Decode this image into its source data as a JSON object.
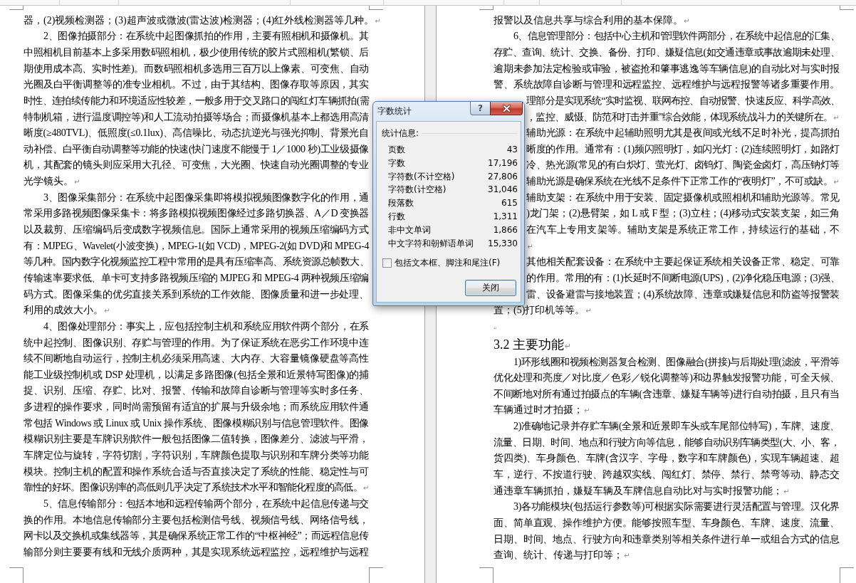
{
  "pages": [
    {
      "paragraphs": [
        {
          "kind": "continued",
          "lines": [
            "器，(2)视频检测器；(3)超声波或微波(雷达波)检测器；(4)红外线检测器等几种。"
          ],
          "end_mark": "↵"
        },
        {
          "kind": "body",
          "lines": [
            "2、图像拍摄部分：在系统中起图像抓拍的作用，主要有照相机和摄像机。其",
            "中照相机目前基本上多采用数码照相机，极少使用传统的胶片式照相机(繁锁、后",
            "期使用成本高、实时性差)。而数码照相机多选用三百万以上像素、可变焦、自动",
            "光圈及白平衡调整等的准专业相机。不过，由于其结构、图像存取等原因，其实",
            "时性、连拍续传能力和环境适应性较差，一般多用于交叉路口的闯红灯车辆抓拍(需",
            "特制机箱，进行温度调控等)和人工流动拍摄等场合；而摄像机基本上都选用高清",
            "晰度(≥480TVL)、低照度(≤0.1lux)、高信噪比、动态抗逆光与强光抑制、背景光自",
            "动补偿、白平衡自动调整等功能的快速(快门速度不能慢于 1／1000 秒)工业级摄像",
            "机，其配套的镜头则应采用大孔径、可变焦，大光圈、快速自动光圈调整的专业",
            "光学镜头。"
          ],
          "end_mark": "↵"
        },
        {
          "kind": "body",
          "lines": [
            "3、图像采集部分：在系统中起图像采集即将模拟视频图像数字化的作用，通",
            "常采用多路视频图像采集卡：将多路模拟视频图像经过多路切换器、A／D 变换器",
            "以及裁剪、压缩编码后变成数字视频信息。国际上通常采用的视频压缩编码方式",
            "有：MJPEG、Wavelet(小波变换)，MPEG-1(如 VCD)，MPEG-2(如 DVD)和 MPEG-4",
            "等几种。国内数字化视频监控工程中常用的是具有压缩率高、系统资源总帧数大、",
            "传输速率要求低、单卡可支持多路视频压缩的 MJPEG 和 MPEG-4 两种视频压缩编",
            "码方式。图像采集的优劣直接关系到系统的工作效能、图像质量和进一步处理、",
            "利用的成效大小。"
          ],
          "end_mark": "↵"
        },
        {
          "kind": "body",
          "lines": [
            "4、图像处理部分：事实上，应包括控制主机和系统应用软件两个部分，在系",
            "统中起控制、图像识别、存贮与管理的作用。为了保证系统在恶劣工作环境中连",
            "续不间断地自动运行，控制主机必须采用高速、大内存、大容量镜像硬盘等高性",
            "能工业级控制机或 DSP 处理机，以满足多路图像(包括全景和近景特写图像)的捕",
            "捉、识别、压缩、存贮、比对、报警、传输和故障自诊断与管理等实时多任务、",
            "多进程的操作要求，同时尚需预留有适宜的扩展与升级余地；而系统应用软件通",
            "常包括 Windows 或 Linux 或 Unix 操作系统、图像模糊识别与信息管理软件。图像",
            "模糊识别主要是车牌识别软件一般包括图像二值转换，图像差分、滤波与平滑，",
            "车牌定位与旋转，字符切割，字符识别，车牌颜色提取与识别和车牌分类等功能",
            "模块。控制主机的配置和操作系统合适与否直接决定了系统的性能、稳定性与可",
            "靠性的好坏。图像识别率的高低则几乎决定了系统技术水平和智能化程度的高低。"
          ],
          "end_mark": "↵"
        },
        {
          "kind": "body",
          "lines": [
            "5、信息传输部分：包括本地和远程传输两个部分，在系统中起信息传递与交",
            "换的作用。本地信息传输部分主要包括检测信号线、视频信号线、网络信号线，",
            "网卡以及交换机或集线器等，其是确保系统正常工作的“中枢神经”；而远程信息传",
            "输部分则主要要有线和无线介质两种，其是实现系统远程监控，远程维护与远程"
          ]
        }
      ]
    },
    {
      "paragraphs": [
        {
          "kind": "continued",
          "lines": [
            "报警以及信息共享与综合利用的基本保障。"
          ],
          "end_mark": "↵"
        },
        {
          "kind": "body",
          "lines": [
            "6、信息管理部分：包括中心主机和管理软件两部分，在系统中起信息的汇集、",
            "存贮、查询、统计、交换、备份、打印、嫌疑信息(如交通违章或事故逾期未处理、",
            "逾期未参加法定检验或审验，被盗抢和肇事逃逸等车辆信息)的自动比对与实时报",
            "警、系统故障自诊断与管理和远程监控、远程维护与远程报警等诸多重要作用。",
            {
              "text": "理部分是实现系统“实时监视、联网布控、自动报警、快速反应、科学高效、",
              "obscured": true
            },
            {
              "text": "，监控、威慑、防范和打击并重”综合效能，体现系统战斗力的关键所在。",
              "obscured": true
            }
          ],
          "end_mark": "↵"
        },
        {
          "kind": "body",
          "lines": [
            {
              "text": "辅助光源：在系统中起辅助照明尤其是夜间或光线不足时补光，提高抓拍",
              "obscured": true
            },
            {
              "text": "晰度的作用。通常有：(1)频闪照明灯，如闪光灯：(2)连续照明灯，如路灯",
              "obscured": true
            },
            {
              "text": "冷、热光源(常见的有白炽灯、萤光灯、卤钨灯、陶瓷金卤灯，高压钠灯等",
              "obscured": true
            },
            {
              "text": "辅助光源是确保系统在光线不足条件下正常工作的“夜明灯”，不可或缺。",
              "obscured": true
            }
          ],
          "end_mark": "↵"
        },
        {
          "kind": "body",
          "lines": [
            {
              "text": "辅助支架：在系统中用于安装、固定摄像机或照相机和辅助光源等。常见",
              "obscured": true
            },
            {
              "text": ")龙门架；(2)悬臂架，如 L 或 F 型；(3)立柱；(4)移动式安装支架，如三角",
              "obscured": true
            },
            {
              "text": "在汽车上专用支架等。辅助支架是系统正常工作，持续运行的基础，不",
              "obscured": true
            },
            {
              "obscured": true
            }
          ],
          "end_mark": "↵"
        },
        {
          "kind": "body",
          "lines": [
            {
              "text": "其他相关配套设备：在系统中主要起保证系统相关设备正常、稳定、可靠",
              "obscured": true
            },
            {
              "text": "的作用。常用的有：(1)长延时不间断电源(UPS)，(2)净化稳压电源；(3)强、",
              "obscured": true
            },
            {
              "text": "雷、设备避雷与接地装置；(4)系统故障、违章或嫌疑信息和防盗等报警装",
              "obscured": true
            },
            "置；(5)打印机等等。"
          ],
          "end_mark": "↵"
        },
        {
          "kind": "blank",
          "end_mark": "↵"
        },
        {
          "kind": "heading",
          "lines": [
            "3.2 主要功能"
          ],
          "end_mark": "↵"
        },
        {
          "kind": "body",
          "lines": [
            "1)环形线圈和视频检测器复合检测、图像融合(拼接)与后期处理(滤波，平滑等",
            "优化处理和亮度／对比度／色彩／锐化调整等)和边界触发报警功能，可全天候、",
            "不间断地对所有通过拍摄点的车辆(含违章、嫌疑车辆等)进行自动拍摄，且只有当",
            "车辆通过时才拍摄；"
          ],
          "end_mark": "↵"
        },
        {
          "kind": "body",
          "lines": [
            "2)准确地记录并存贮车辆(全景和近景即车头或车尾部位特写)，车牌、速度、",
            "流量、日期、时间、地点和行驶方向等信息，能够自动识别车辆类型(大、小、客，",
            "货四类)、车身颜色、车牌(含汉字、字母，数字和车牌颜色)，实现车辆超速、超",
            "车，逆行、不按道行驶、跨越双实线、闯红灯、禁停、禁行、禁弯等动、静态交",
            "通违章车辆抓拍，嫌疑车辆及车牌信息自动比对与实时报警功能；"
          ],
          "end_mark": "↵"
        },
        {
          "kind": "body",
          "lines": [
            "3)各功能模块(包括运行参数等)可根据实际需要进行灵活配置与管理。汉化界",
            "面、简单直观、操作维护方便。能够按照车型、车身颜色、车牌、速度、流量、",
            "日期、时间、地点、行驶方向和违章类别等相关条件进行单一或组合方式的信息",
            "查询、统计、传递与打印等；"
          ],
          "end_mark": "↵"
        }
      ]
    }
  ],
  "dialog": {
    "title": "字数统计",
    "help_button": "?",
    "section_label": "统计信息:",
    "stats": [
      {
        "label": "页数",
        "value": "43"
      },
      {
        "label": "字数",
        "value": "17,196"
      },
      {
        "label": "字符数(不计空格)",
        "value": "27,806"
      },
      {
        "label": "字符数(计空格)",
        "value": "31,046"
      },
      {
        "label": "段落数",
        "value": "615"
      },
      {
        "label": "行数",
        "value": "1,311"
      },
      {
        "label": "非中文单词",
        "value": "1,866"
      },
      {
        "label": "中文字符和朝鲜语单词",
        "value": "15,330"
      }
    ],
    "checkbox": {
      "label": "包括文本框、脚注和尾注(F)",
      "checked": false
    },
    "button": "关闭"
  }
}
